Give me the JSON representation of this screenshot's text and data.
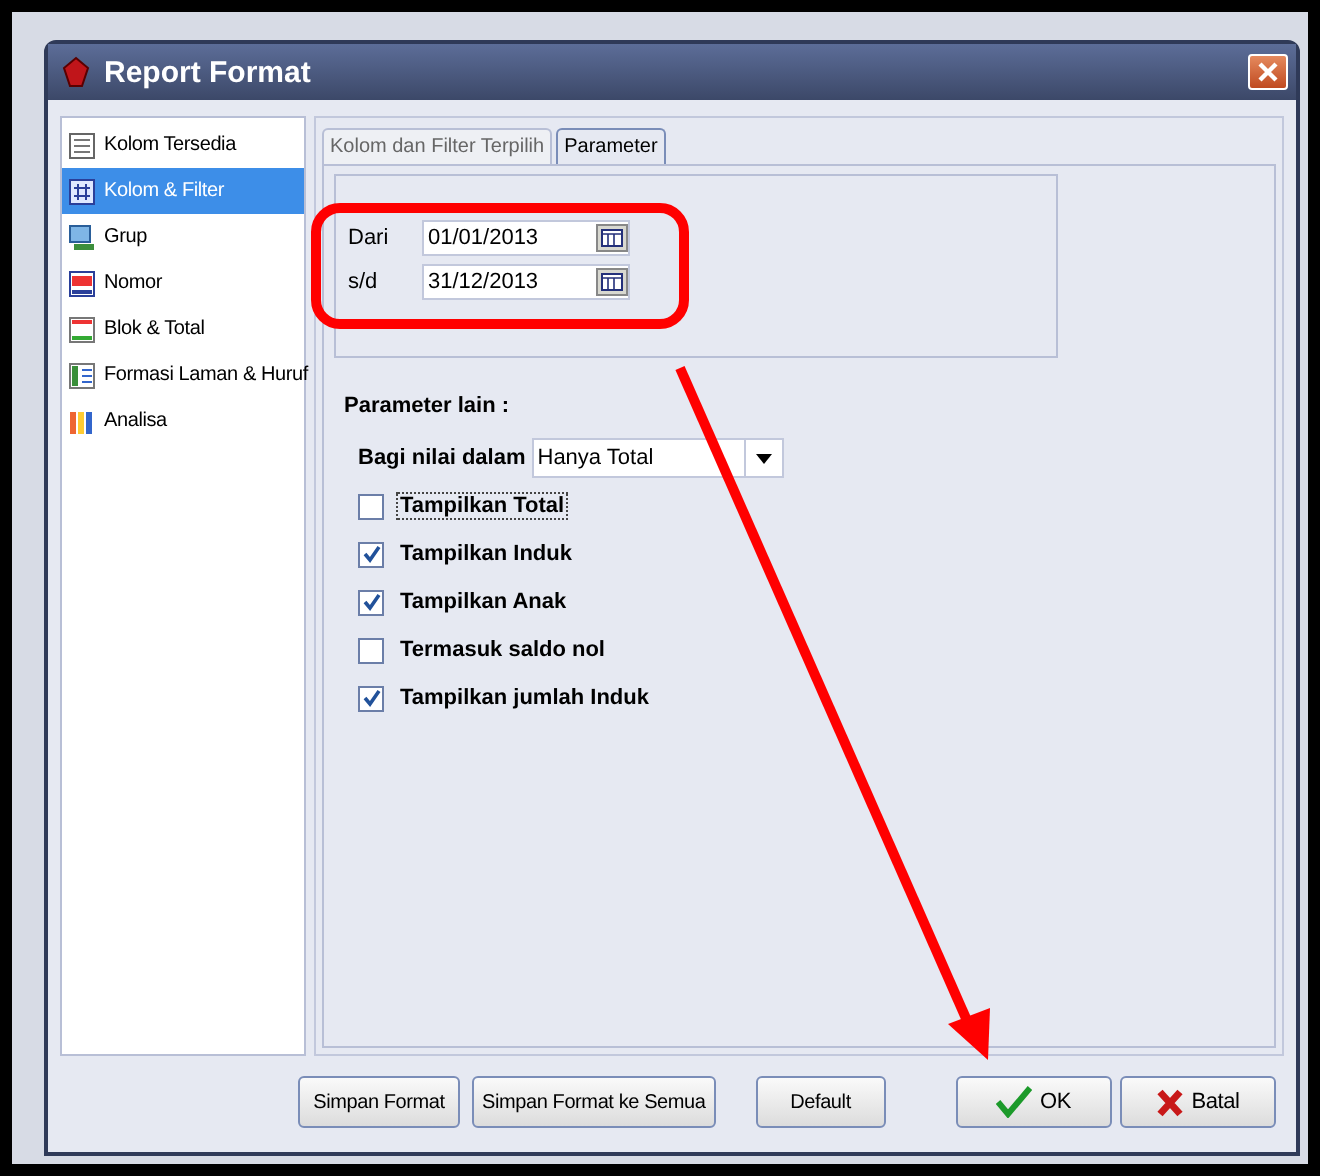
{
  "window": {
    "title": "Report Format"
  },
  "sidebar": {
    "items": [
      {
        "label": "Kolom Tersedia",
        "selected": false
      },
      {
        "label": "Kolom & Filter",
        "selected": true
      },
      {
        "label": "Grup",
        "selected": false
      },
      {
        "label": "Nomor",
        "selected": false
      },
      {
        "label": "Blok & Total",
        "selected": false
      },
      {
        "label": "Formasi Laman & Huruf",
        "selected": false
      },
      {
        "label": "Analisa",
        "selected": false
      }
    ]
  },
  "tabs": [
    {
      "label": "Kolom dan Filter Terpilih",
      "selected": false
    },
    {
      "label": "Parameter",
      "selected": true
    }
  ],
  "date_fields": [
    {
      "label": "Dari",
      "value": "01/01/2013"
    },
    {
      "label": "s/d",
      "value": "31/12/2013"
    }
  ],
  "other_params": {
    "heading": "Parameter lain :",
    "dropdown": {
      "label": "Bagi nilai dalam",
      "value": "Hanya Total"
    },
    "checkboxes": [
      {
        "label": "Tampilkan Total",
        "checked": false,
        "focused": true
      },
      {
        "label": "Tampilkan Induk",
        "checked": true,
        "focused": false
      },
      {
        "label": "Tampilkan Anak",
        "checked": true,
        "focused": false
      },
      {
        "label": "Termasuk saldo nol",
        "checked": false,
        "focused": false
      },
      {
        "label": "Tampilkan jumlah Induk",
        "checked": true,
        "focused": false
      }
    ]
  },
  "buttons": [
    {
      "label": "Simpan Format",
      "kind": "plain"
    },
    {
      "label": "Simpan Format ke Semua",
      "kind": "plain"
    },
    {
      "label": "Default",
      "kind": "plain"
    },
    {
      "label": "OK",
      "kind": "ok"
    },
    {
      "label": "Batal",
      "kind": "cancel"
    }
  ]
}
